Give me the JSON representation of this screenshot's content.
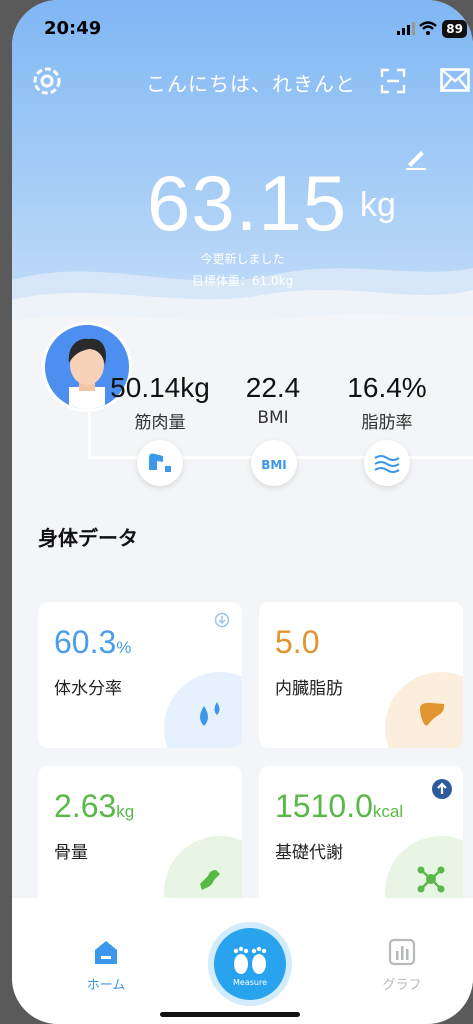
{
  "status_bar": {
    "time": "20:49",
    "battery": "89"
  },
  "header": {
    "greeting": "こんにちは、れきんと",
    "weight_value": "63.15",
    "weight_unit": "kg",
    "updated_text": "今更新しました",
    "target_text": "目標体重：61.0kg"
  },
  "metrics": [
    {
      "value": "50.14kg",
      "label": "筋肉量",
      "icon": "muscle-icon"
    },
    {
      "value": "22.4",
      "label": "BMI",
      "icon": "bmi-icon"
    },
    {
      "value": "16.4%",
      "label": "脂肪率",
      "icon": "fat-icon"
    }
  ],
  "section_title": "身体データ",
  "cards": [
    {
      "value": "60.3",
      "unit": "%",
      "name": "体水分率",
      "color": "#4a9de8",
      "icon": "water-drops-icon",
      "trend_icon": "arrow-down-icon"
    },
    {
      "value": "5.0",
      "unit": "",
      "name": "内臓脂肪",
      "color": "#e0952e",
      "icon": "liver-icon"
    },
    {
      "value": "2.63",
      "unit": "kg",
      "name": "骨量",
      "color": "#58b947",
      "icon": "bone-icon"
    },
    {
      "value": "1510.0",
      "unit": "kcal",
      "name": "基礎代謝",
      "color": "#58b947",
      "icon": "molecule-icon",
      "trend_icon": "arrow-up-icon"
    }
  ],
  "nav": {
    "home_label": "ホーム",
    "measure_label": "Measure",
    "graph_label": "グラフ"
  },
  "colors": {
    "accent": "#2aa3ee",
    "header_top": "#7fb6f4"
  }
}
